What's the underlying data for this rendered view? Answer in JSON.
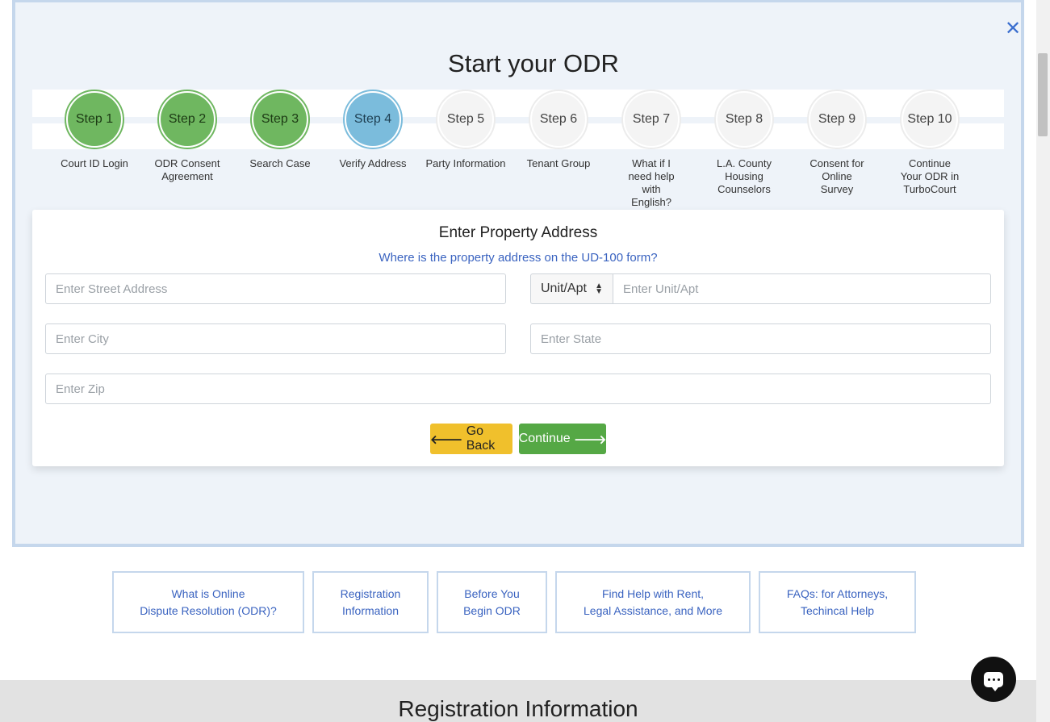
{
  "modal": {
    "title": "Start your ODR",
    "close_icon": "close-icon"
  },
  "steps": [
    {
      "label": "Step 1",
      "caption": "Court ID Login",
      "status": "done"
    },
    {
      "label": "Step 2",
      "caption": "ODR Consent Agreement",
      "status": "done"
    },
    {
      "label": "Step 3",
      "caption": "Search Case",
      "status": "done"
    },
    {
      "label": "Step 4",
      "caption": "Verify Address",
      "status": "active"
    },
    {
      "label": "Step 5",
      "caption": "Party Information",
      "status": "todo"
    },
    {
      "label": "Step 6",
      "caption": "Tenant Group",
      "status": "todo"
    },
    {
      "label": "Step 7",
      "caption": "What if I need help with English?",
      "status": "todo"
    },
    {
      "label": "Step 8",
      "caption": "L.A. County Housing Counselors",
      "status": "todo"
    },
    {
      "label": "Step 9",
      "caption": "Consent for Online Survey",
      "status": "todo"
    },
    {
      "label": "Step 10",
      "caption": "Continue Your ODR in TurboCourt",
      "status": "todo"
    }
  ],
  "form": {
    "title": "Enter Property Address",
    "help_link": "Where is the property address on the UD-100 form?",
    "street": {
      "placeholder": "Enter Street Address",
      "value": ""
    },
    "unit_type": {
      "selected": "Unit/Apt"
    },
    "unit": {
      "placeholder": "Enter Unit/Apt",
      "value": ""
    },
    "city": {
      "placeholder": "Enter City",
      "value": ""
    },
    "state": {
      "placeholder": "Enter State",
      "value": ""
    },
    "zip": {
      "placeholder": "Enter Zip",
      "value": ""
    },
    "back_label": "Go Back",
    "continue_label": "Continue"
  },
  "links": [
    {
      "line1": "What is Online",
      "line2": "Dispute Resolution (ODR)?"
    },
    {
      "line1": "Registration",
      "line2": "Information"
    },
    {
      "line1": "Before You",
      "line2": "Begin ODR"
    },
    {
      "line1": "Find Help with Rent,",
      "line2": "Legal Assistance, and More"
    },
    {
      "line1": "FAQs: for Attorneys,",
      "line2": "Techincal Help"
    }
  ],
  "section": {
    "title": "Registration Information"
  },
  "colors": {
    "done": "#6fb760",
    "active": "#7bbcdc",
    "link": "#3a63c0",
    "back_button": "#f0c02c",
    "continue_button": "#55a845"
  }
}
